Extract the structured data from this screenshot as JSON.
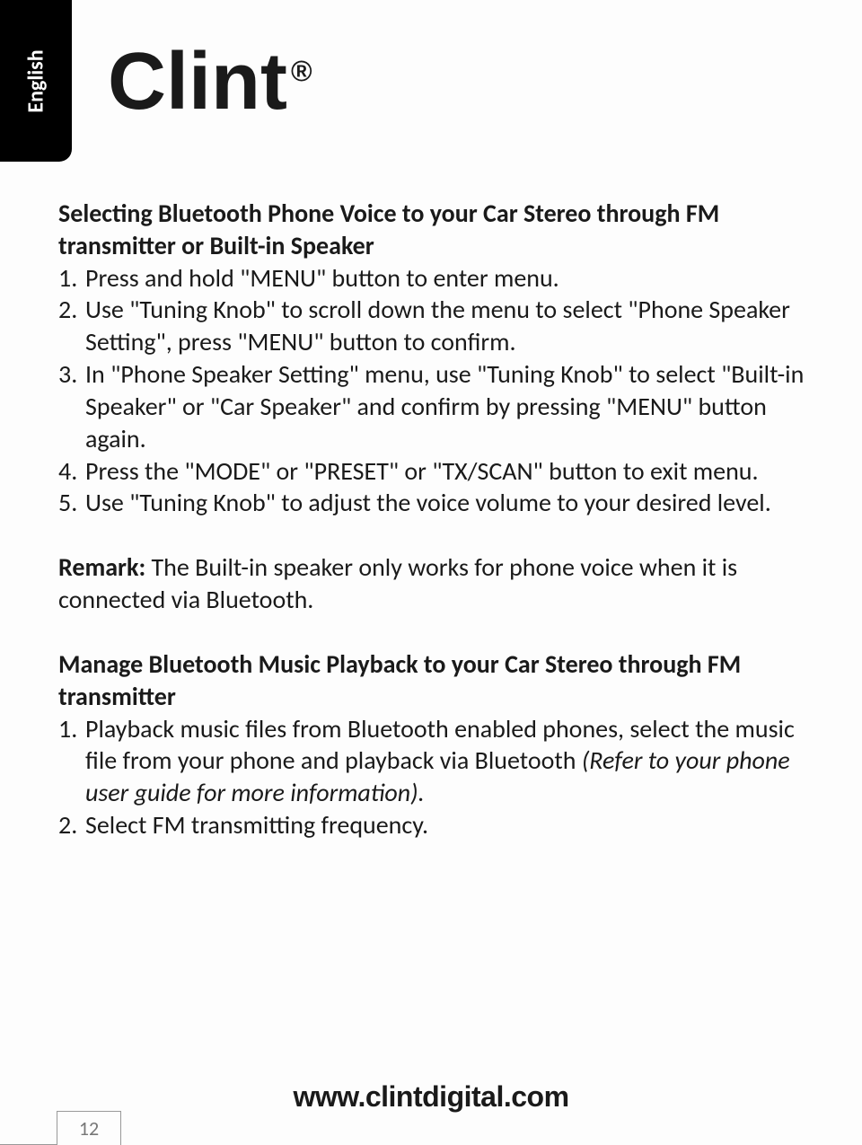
{
  "language_tab": "English",
  "brand": "Clint",
  "brand_reg": "®",
  "section1": {
    "title": "Selecting Bluetooth Phone Voice to your Car Stereo through FM transmitter or Built-in Speaker",
    "items": [
      {
        "num": "1.",
        "text": "Press and hold \"MENU\" button to enter menu."
      },
      {
        "num": "2.",
        "text": "Use \"Tuning Knob\" to scroll down the menu to select \"Phone Speaker Setting\", press \"MENU\" button to confirm."
      },
      {
        "num": "3.",
        "text": "In \"Phone Speaker Setting\" menu, use \"Tuning Knob\" to select \"Built-in Speaker\" or \"Car Speaker\" and confirm by pressing \"MENU\" button again."
      },
      {
        "num": "4.",
        "text": "Press the \"MODE\" or \"PRESET\" or \"TX/SCAN\" button to exit menu."
      },
      {
        "num": "5.",
        "text": "Use \"Tuning Knob\" to adjust the voice volume to your desired level."
      }
    ]
  },
  "remark": {
    "label": "Remark:",
    "text": "  The Built-in speaker only works for phone voice when it is connected via Bluetooth."
  },
  "section2": {
    "title": "Manage Bluetooth Music Playback to your Car Stereo through FM transmitter",
    "items": [
      {
        "num": "1.",
        "text": "Playback music files from Bluetooth enabled phones, select the music file from your phone and playback via Bluetooth ",
        "italic": "(Refer to your phone user guide for more information)."
      },
      {
        "num": "2.",
        "text": "Select FM transmitting frequency."
      }
    ]
  },
  "footer_url": "www.clintdigital.com",
  "page_number": "12"
}
